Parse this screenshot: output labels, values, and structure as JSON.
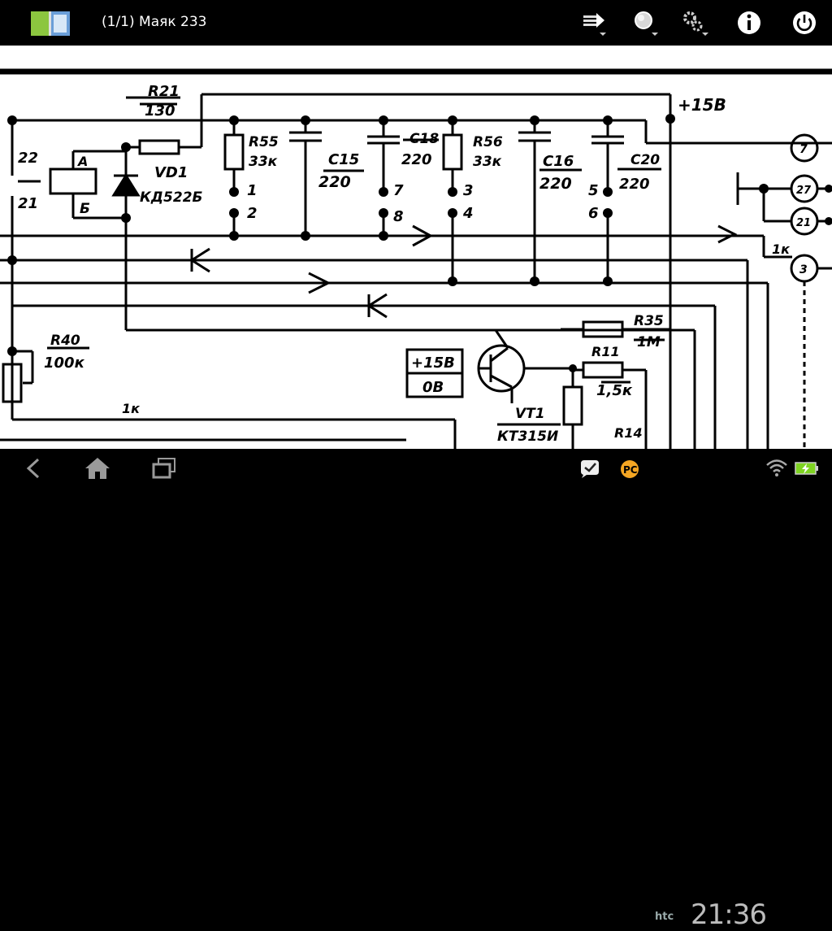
{
  "action_bar": {
    "title": "(1/1) Маяк 233",
    "buttons": [
      {
        "name": "goto-page",
        "icon": "arrow-page-icon"
      },
      {
        "name": "zoom",
        "icon": "magnifier-icon"
      },
      {
        "name": "settings",
        "icon": "gear-icon"
      },
      {
        "name": "info",
        "icon": "info-icon"
      },
      {
        "name": "exit",
        "icon": "power-icon"
      }
    ]
  },
  "schematic": {
    "labels": {
      "r21_ref": "R21",
      "r21_val": "130",
      "plus15v_top": "+15В",
      "r55_ref": "R55",
      "r55_val": "33к",
      "c15_ref": "C15",
      "c15_val": "220",
      "c18_ref": "C18",
      "c18_val": "220",
      "r56_ref": "R56",
      "r56_val": "33к",
      "c16_ref": "C16",
      "c16_val": "220",
      "c20_ref": "C20",
      "c20_val": "220",
      "vd1_ref": "VD1",
      "vd1_val": "КД522Б",
      "relay_a": "А",
      "relay_b": "Б",
      "pin_22": "22",
      "pin_21": "21",
      "pin_1": "1",
      "pin_2": "2",
      "pin_7": "7",
      "pin_8": "8",
      "pin_3": "3",
      "pin_4": "4",
      "pin_5": "5",
      "pin_6": "6",
      "conn_7": "7",
      "conn_27": "27",
      "conn_21": "21",
      "conn_3": "3",
      "label_1k_right": "1к",
      "label_1k_left": "1к",
      "r40_ref": "R40",
      "r40_val": "100к",
      "box_plus15": "+15В",
      "box_0v": "0В",
      "r35_ref": "R35",
      "r35_val": "1М",
      "r11_ref": "R11",
      "r11_val": "1,5к",
      "vt1_ref": "VT1",
      "vt1_val": "КТ315И",
      "r14_ref": "R14"
    }
  },
  "status_bar": {
    "clock": "21:36",
    "carrier": "htc"
  },
  "colors": {
    "battery": "#7ed321",
    "bars": "#000000",
    "canvas": "#ffffff"
  }
}
